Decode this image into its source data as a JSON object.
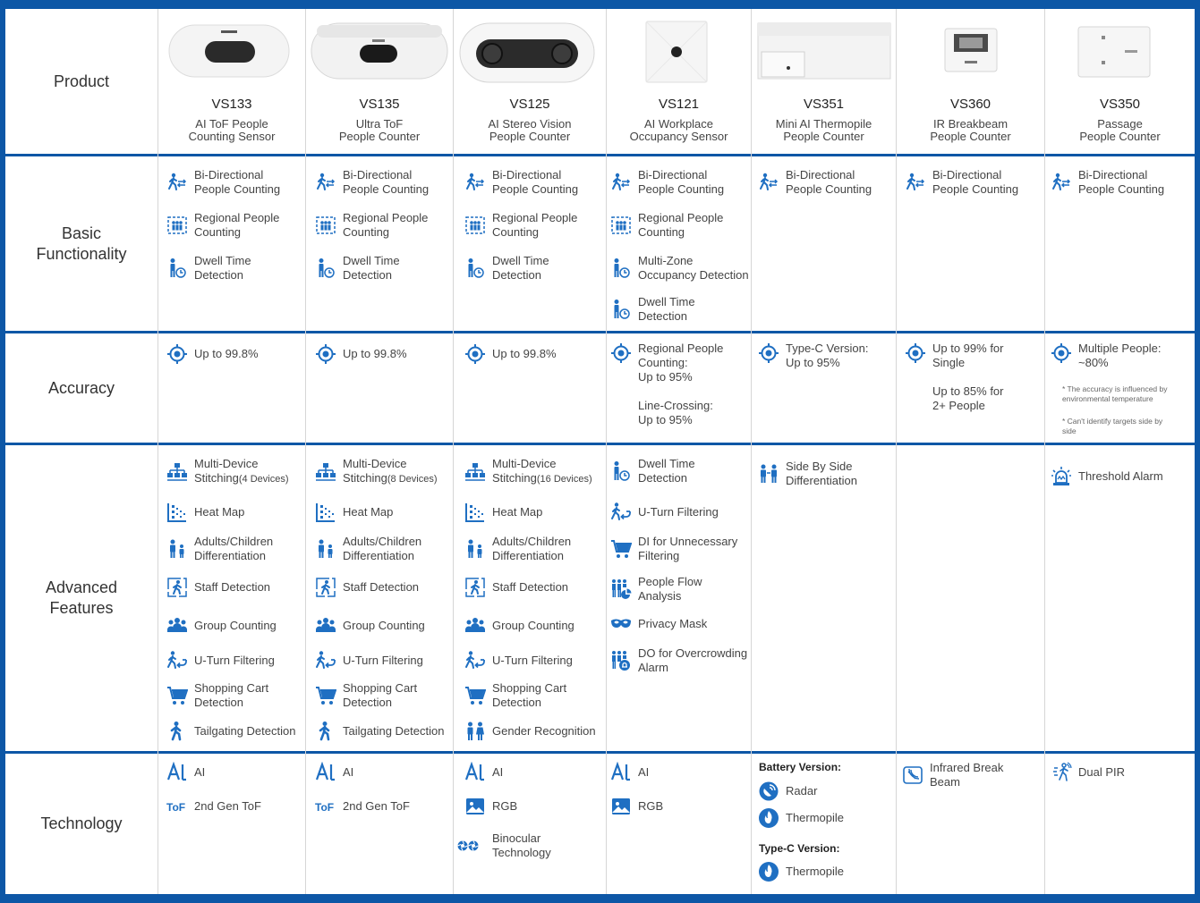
{
  "rows": {
    "product": "Product",
    "basic": "Basic Functionality",
    "accuracy": "Accuracy",
    "advanced": "Advanced Features",
    "technology": "Technology"
  },
  "products": [
    {
      "name": "VS133",
      "desc1": "AI ToF People",
      "desc2": "Counting Sensor"
    },
    {
      "name": "VS135",
      "desc1": "Ultra ToF",
      "desc2": "People Counter"
    },
    {
      "name": "VS125",
      "desc1": "AI Stereo Vision",
      "desc2": "People Counter"
    },
    {
      "name": "VS121",
      "desc1": "AI Workplace",
      "desc2": "Occupancy Sensor"
    },
    {
      "name": "VS351",
      "desc1": "Mini AI Thermopile",
      "desc2": "People Counter"
    },
    {
      "name": "VS360",
      "desc1": "IR Breakbeam",
      "desc2": "People Counter"
    },
    {
      "name": "VS350",
      "desc1": "Passage",
      "desc2": "People Counter"
    }
  ],
  "basic": {
    "bidir1": "Bi-Directional",
    "bidir2": "People Counting",
    "region1": "Regional People",
    "region2": "Counting",
    "dwell1": "Dwell Time",
    "dwell2": "Detection",
    "multizone1": "Multi-Zone",
    "multizone2": "Occupancy Detection"
  },
  "accuracy": {
    "a998": "Up to 99.8%",
    "vs121_1": "Regional People",
    "vs121_2": "Counting:",
    "vs121_3": "Up to 95%",
    "vs121_4": "Line-Crossing:",
    "vs121_5": "Up to 95%",
    "vs351_1": "Type-C Version:",
    "vs351_2": "Up to 95%",
    "vs360_1": "Up to 99% for",
    "vs360_2": "Single",
    "vs360_3": "Up to 85% for",
    "vs360_4": "2+ People",
    "vs350_1": "Multiple People:",
    "vs350_2": "~80%",
    "note1a": "* The accuracy is influenced by",
    "note1b": "environmental temperature",
    "note2a": "* Can't identify targets side by",
    "note2b": "side"
  },
  "advanced": {
    "stitch1": "Multi-Device",
    "stitch2": "Stitching",
    "dev4": "(4 Devices)",
    "dev8": "(8 Devices)",
    "dev16": "(16 Devices)",
    "heatmap": "Heat Map",
    "adults1": "Adults/Children",
    "adults2": "Differentiation",
    "staff": "Staff Detection",
    "group": "Group Counting",
    "uturn": "U-Turn Filtering",
    "cart1": "Shopping Cart",
    "cart2": "Detection",
    "tailgate": "Tailgating Detection",
    "gender": "Gender Recognition",
    "dwell1": "Dwell Time",
    "dwell2": "Detection",
    "di1": "DI for Unnecessary",
    "di2": "Filtering",
    "flow1": "People Flow",
    "flow2": "Analysis",
    "privacy": "Privacy Mask",
    "do1": "DO for Overcrowding",
    "do2": "Alarm",
    "side1": "Side By Side",
    "side2": "Differentiation",
    "threshold": "Threshold Alarm"
  },
  "technology": {
    "ai": "AI",
    "tof": "2nd Gen ToF",
    "rgb": "RGB",
    "bino1": "Binocular",
    "bino2": "Technology",
    "battery": "Battery Version:",
    "radar": "Radar",
    "thermopile": "Thermopile",
    "typec": "Type-C Version:",
    "ir1": "Infrared Break",
    "ir2": "Beam",
    "pir": "Dual PIR"
  },
  "colors": {
    "accent": "#0d57a6",
    "icon": "#1f6fc2",
    "grid": "#d6d6d6"
  }
}
